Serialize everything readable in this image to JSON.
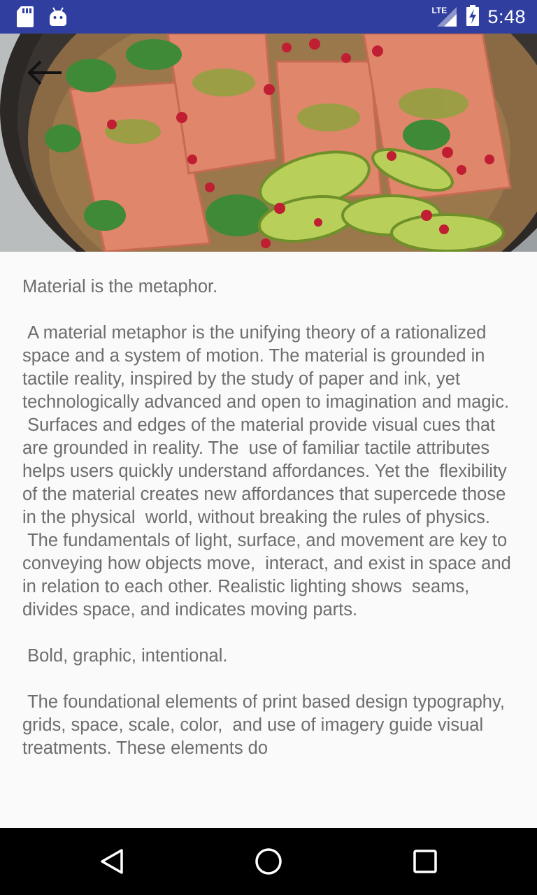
{
  "status_bar": {
    "time": "5:48",
    "network_label": "LTE",
    "icons": [
      "sd-card-icon",
      "android-debug-icon",
      "lte-signal-icon",
      "battery-charging-icon"
    ]
  },
  "header": {
    "image": "salmon-quinoa-avocado-skillet-photo",
    "back_icon": "arrow-left-icon"
  },
  "article": {
    "text": "Material is the metaphor.\n\n A material metaphor is the unifying theory of a rationalized space and a system of motion. The material is grounded in tactile reality, inspired by the study of paper and ink, yet  technologically advanced and open to imagination and magic.\n Surfaces and edges of the material provide visual cues that are grounded in reality. The  use of familiar tactile attributes helps users quickly understand affordances. Yet the  flexibility of the material creates new affordances that supercede those in the physical  world, without breaking the rules of physics.\n The fundamentals of light, surface, and movement are key to conveying how objects move,  interact, and exist in space and in relation to each other. Realistic lighting shows  seams, divides space, and indicates moving parts.\n\n Bold, graphic, intentional.\n\n The foundational elements of print based design typography, grids, space, scale, color,  and use of imagery guide visual treatments. These elements do"
  },
  "nav_bar": {
    "buttons": [
      "back-triangle-icon",
      "home-circle-icon",
      "recents-square-icon"
    ]
  },
  "colors": {
    "status_bar": "#303f9f",
    "background": "#fafafa",
    "text": "#6d6d6d",
    "nav_bar": "#000000"
  }
}
